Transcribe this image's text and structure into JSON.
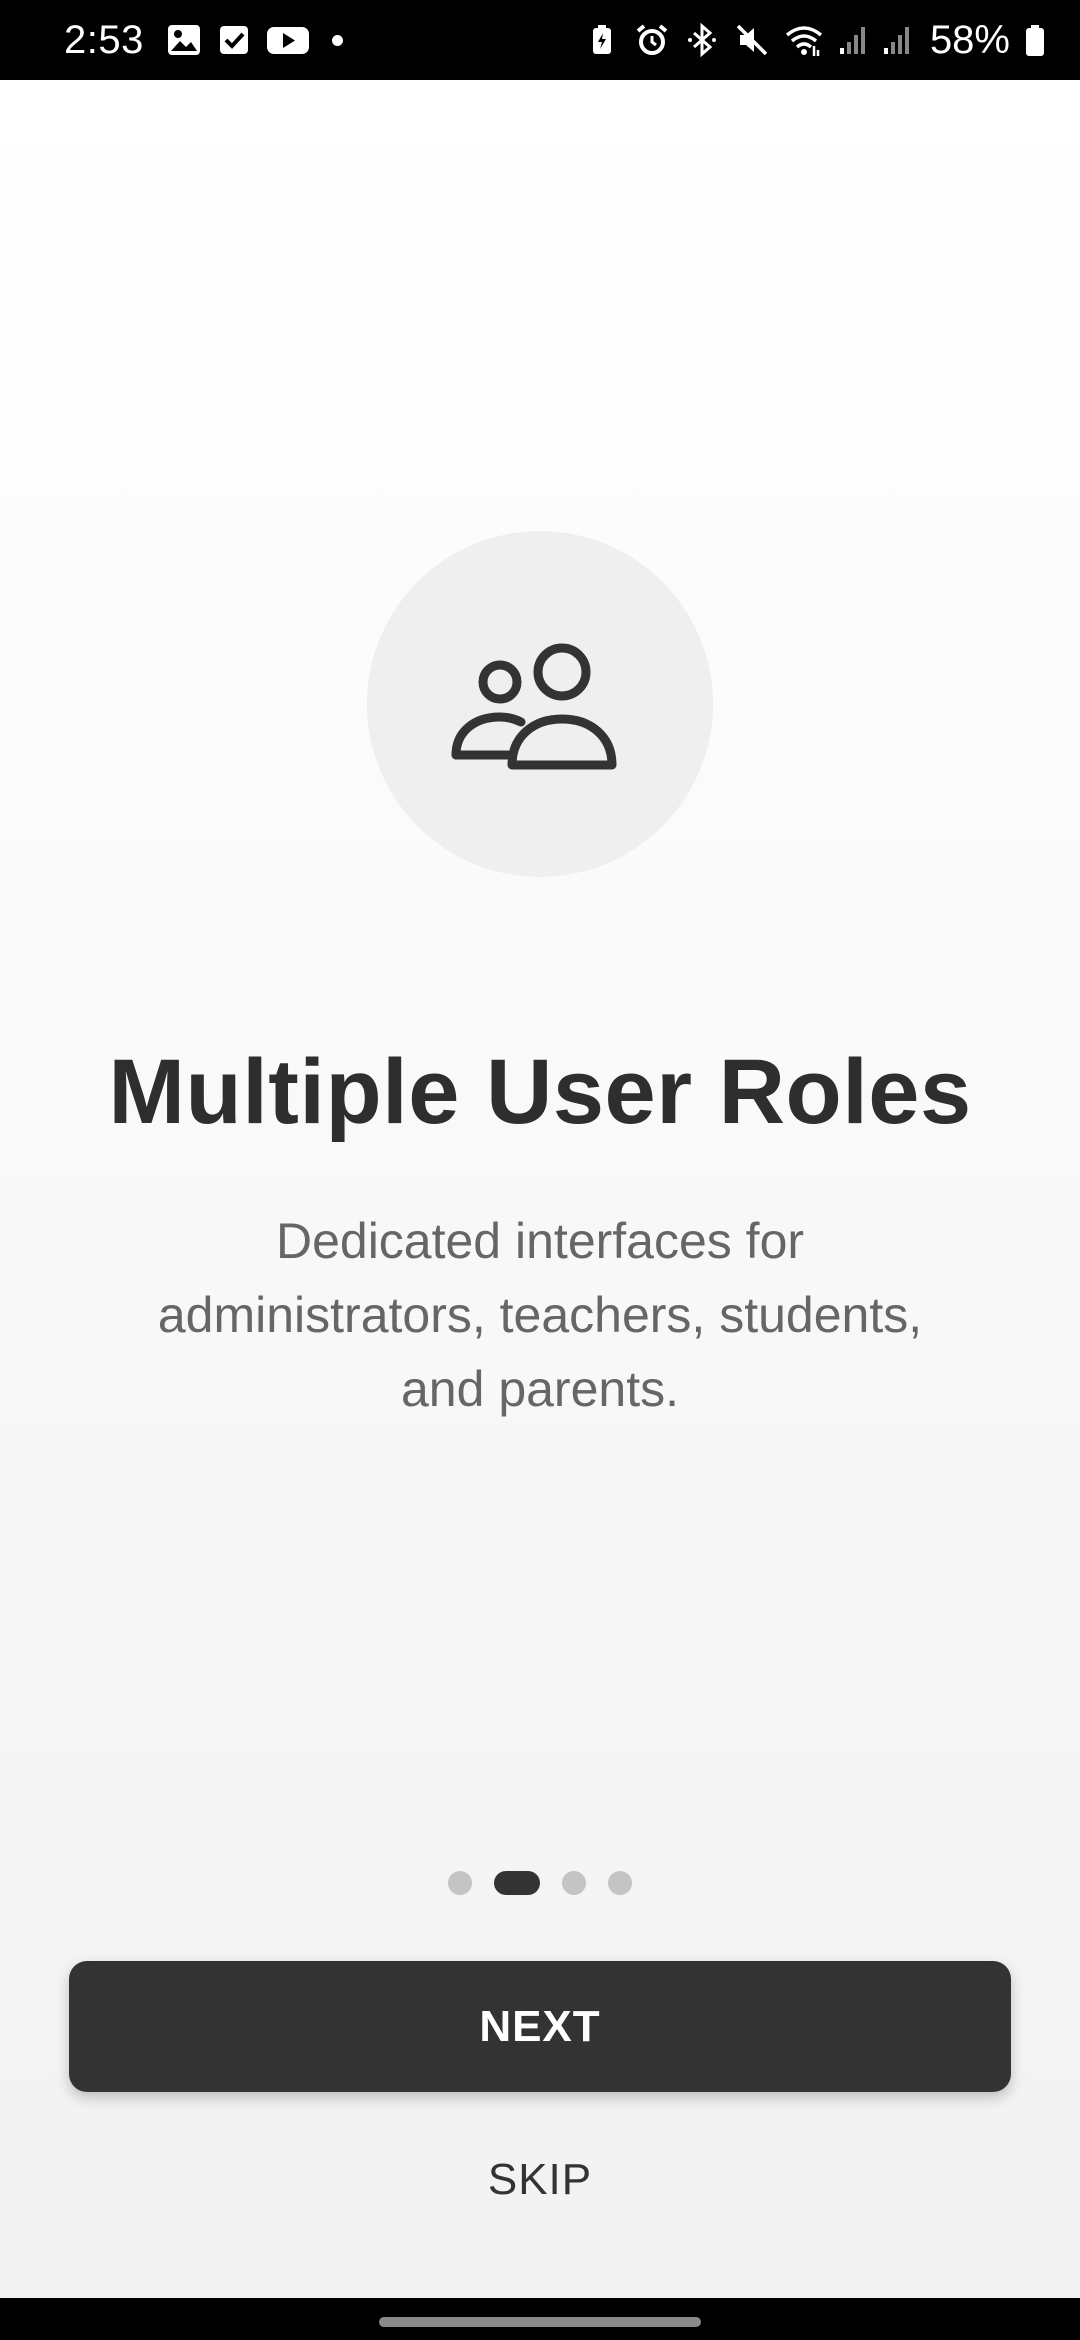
{
  "status_bar": {
    "time": "2:53",
    "battery_percent": "58%",
    "left_icons": [
      "gallery-icon",
      "checkbox-icon",
      "youtube-icon",
      "notification-dot"
    ],
    "right_icons": [
      "battery-saver-icon",
      "alarm-icon",
      "bluetooth-icon",
      "mute-icon",
      "wifi-icon",
      "signal-icon",
      "signal-icon-2",
      "battery-icon"
    ]
  },
  "onboarding": {
    "icon": "users-icon",
    "title": "Multiple User Roles",
    "description": "Dedicated interfaces for administrators, teachers, students, and parents.",
    "page_indicator": {
      "total": 4,
      "current": 2
    },
    "next_label": "NEXT",
    "skip_label": "SKIP"
  },
  "colors": {
    "primary_button": "#333333",
    "text_primary": "#2e2e2e",
    "text_secondary": "#666666",
    "icon_circle": "#efefef"
  }
}
